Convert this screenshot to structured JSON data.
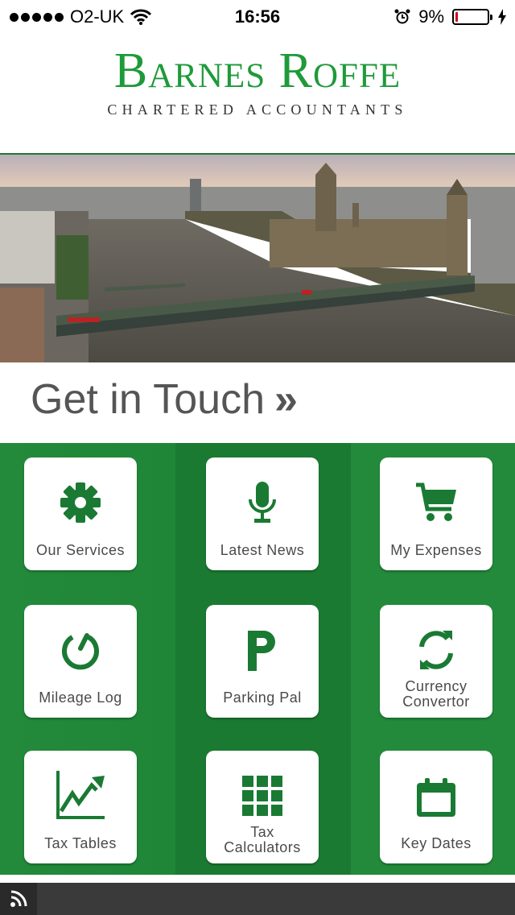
{
  "status_bar": {
    "carrier": "O2-UK",
    "time": "16:56",
    "battery_percent": "9%",
    "battery_level": 0.09,
    "icons": [
      "signal-dots-icon",
      "wifi-icon",
      "alarm-icon",
      "battery-icon",
      "charging-bolt-icon"
    ]
  },
  "brand": {
    "name": "Barnes Roffe",
    "tagline": "CHARTERED ACCOUNTANTS",
    "color": "#1f9a3a"
  },
  "hero": {
    "description_icon": "london-westminster-photo"
  },
  "contact": {
    "label": "Get in Touch",
    "arrow": "»"
  },
  "tiles": [
    {
      "label": "Our Services",
      "icon": "gear-icon"
    },
    {
      "label": "Latest News",
      "icon": "microphone-icon"
    },
    {
      "label": "My Expenses",
      "icon": "shopping-cart-icon"
    },
    {
      "label": "Mileage Log",
      "icon": "power-icon"
    },
    {
      "label": "Parking Pal",
      "icon": "parking-icon"
    },
    {
      "label_line1": "Currency",
      "label_line2": "Convertor",
      "icon": "refresh-icon"
    },
    {
      "label": "Tax Tables",
      "icon": "line-chart-icon"
    },
    {
      "label_line1": "Tax",
      "label_line2": "Calculators",
      "icon": "grid-icon"
    },
    {
      "label": "Key Dates",
      "icon": "calendar-icon"
    }
  ],
  "colors": {
    "accent_green": "#1f8637",
    "icon_green": "#1a7a33",
    "footer": "#3a3a3a"
  },
  "footer": {
    "icon": "rss-icon"
  }
}
